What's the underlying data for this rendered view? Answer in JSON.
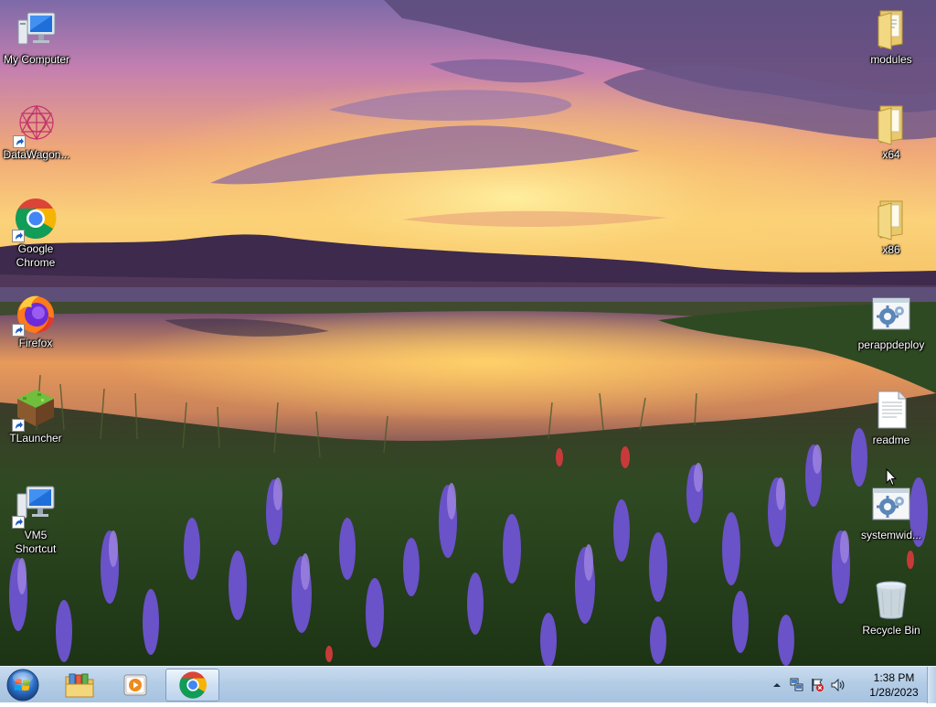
{
  "desktop": {
    "left_icons": [
      {
        "label": "My Computer",
        "icon": "computer-icon"
      },
      {
        "label": "DataWagon...",
        "icon": "datawagon-icon"
      },
      {
        "label": "Google\nChrome",
        "icon": "chrome-icon"
      },
      {
        "label": "Firefox",
        "icon": "firefox-icon"
      },
      {
        "label": "TLauncher",
        "icon": "tlauncher-icon"
      },
      {
        "label": "VM5\nShortcut",
        "icon": "computer-icon"
      }
    ],
    "right_icons": [
      {
        "label": "modules",
        "icon": "folder-icon"
      },
      {
        "label": "x64",
        "icon": "folder-icon"
      },
      {
        "label": "x86",
        "icon": "folder-icon"
      },
      {
        "label": "perappdeploy",
        "icon": "settings-file-icon"
      },
      {
        "label": "readme",
        "icon": "text-file-icon"
      },
      {
        "label": "systemwid...",
        "icon": "settings-file-icon"
      },
      {
        "label": "Recycle Bin",
        "icon": "recycle-bin-icon"
      }
    ]
  },
  "taskbar": {
    "start": {
      "icon": "windows-logo-icon"
    },
    "pinned": [
      {
        "name": "explorer",
        "icon": "folder-library-icon"
      },
      {
        "name": "media-player",
        "icon": "media-player-icon"
      },
      {
        "name": "chrome",
        "icon": "chrome-icon",
        "active": true
      }
    ],
    "tray": {
      "icons": [
        "show-hidden-icons-chevron",
        "network-icon",
        "action-center-flag-icon",
        "volume-icon"
      ],
      "time": "1:38 PM",
      "date": "1/28/2023"
    }
  },
  "colors": {
    "taskbar_top": "#c9dcef",
    "taskbar_bottom": "#a6c2e0",
    "label_text": "#ffffff"
  }
}
